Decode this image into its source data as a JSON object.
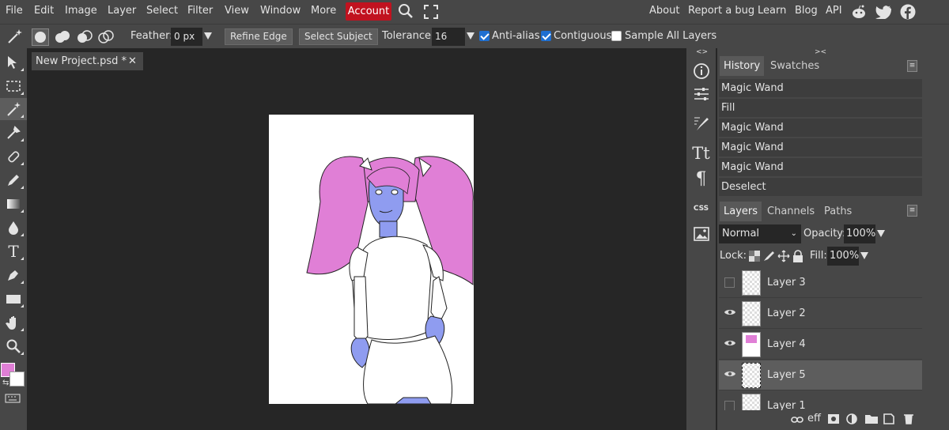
{
  "menu": {
    "items": [
      "File",
      "Edit",
      "Image",
      "Layer",
      "Select",
      "Filter",
      "View",
      "Window",
      "More"
    ],
    "account": "Account",
    "right_items": [
      "About",
      "Report a bug",
      "Learn",
      "Blog",
      "API"
    ],
    "icons": [
      "search-icon",
      "fullscreen-icon",
      "reddit-icon",
      "twitter-icon",
      "facebook-icon"
    ]
  },
  "options": {
    "feather_label": "Feather:",
    "feather_value": "0 px",
    "refine_edge": "Refine Edge",
    "select_subject": "Select Subject",
    "tolerance_label": "Tolerance:",
    "tolerance_value": "16",
    "anti_alias": "Anti-alias",
    "contiguous": "Contiguous",
    "sample_all": "Sample All Layers",
    "anti_alias_checked": true,
    "contiguous_checked": true,
    "sample_all_checked": false
  },
  "document": {
    "tab_title": "New Project.psd *",
    "close": "✕"
  },
  "colors": {
    "foreground": "#e07fd6",
    "background": "#ffffff",
    "accent": "#c1121f"
  },
  "strip": {
    "css_label": "CSS",
    "text_label": "Tt",
    "para_label": "¶",
    "info_label": "i"
  },
  "history": {
    "tabs": [
      "History",
      "Swatches"
    ],
    "entries": [
      "Magic Wand",
      "Fill",
      "Magic Wand",
      "Magic Wand",
      "Magic Wand",
      "Deselect"
    ]
  },
  "layers": {
    "tabs": [
      "Layers",
      "Channels",
      "Paths"
    ],
    "blend_mode": "Normal",
    "opacity_label": "Opacity:",
    "opacity_value": "100%",
    "lock_label": "Lock:",
    "fill_label": "Fill:",
    "fill_value": "100%",
    "items": [
      {
        "name": "Layer 3",
        "visible": false
      },
      {
        "name": "Layer 2",
        "visible": true
      },
      {
        "name": "Layer 4",
        "visible": true
      },
      {
        "name": "Layer 5",
        "visible": true
      },
      {
        "name": "Layer 1",
        "visible": false
      }
    ],
    "footer": [
      "link-icon",
      "eff",
      "mask-icon",
      "adjustment-icon",
      "folder-icon",
      "new-layer-icon",
      "trash-icon"
    ]
  }
}
